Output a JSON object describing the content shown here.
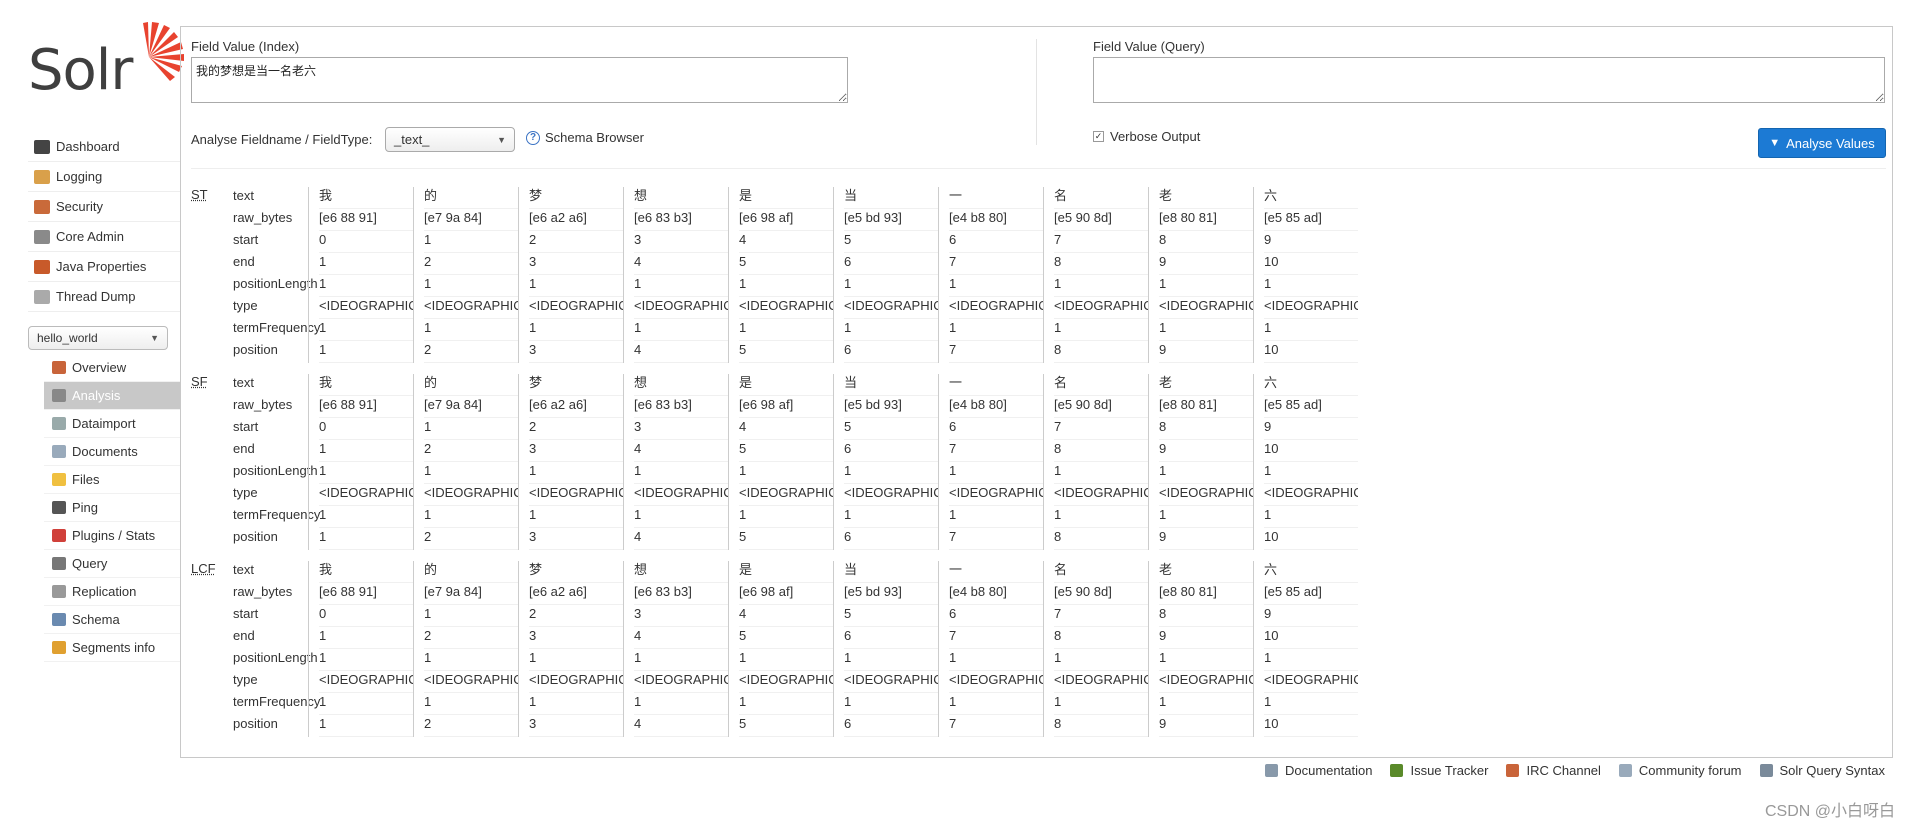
{
  "app": {
    "logo_text": "Solr"
  },
  "nav": [
    {
      "label": "Dashboard",
      "icon": "dashboard-icon",
      "color": "#444"
    },
    {
      "label": "Logging",
      "icon": "logging-icon",
      "color": "#d9a04a"
    },
    {
      "label": "Security",
      "icon": "security-icon",
      "color": "#c96a3a"
    },
    {
      "label": "Core Admin",
      "icon": "core-admin-icon",
      "color": "#8a8a8a"
    },
    {
      "label": "Java Properties",
      "icon": "java-properties-icon",
      "color": "#c85a2a"
    },
    {
      "label": "Thread Dump",
      "icon": "thread-dump-icon",
      "color": "#aaa"
    }
  ],
  "core_selector": {
    "value": "hello_world"
  },
  "core_nav": [
    {
      "label": "Overview",
      "icon": "overview-icon",
      "color": "#c8643a"
    },
    {
      "label": "Analysis",
      "icon": "analysis-icon",
      "color": "#888",
      "active": true
    },
    {
      "label": "Dataimport",
      "icon": "dataimport-icon",
      "color": "#9aa"
    },
    {
      "label": "Documents",
      "icon": "documents-icon",
      "color": "#9ab"
    },
    {
      "label": "Files",
      "icon": "files-icon",
      "color": "#f0c040"
    },
    {
      "label": "Ping",
      "icon": "ping-icon",
      "color": "#555"
    },
    {
      "label": "Plugins / Stats",
      "icon": "plugins-icon",
      "color": "#d0403a"
    },
    {
      "label": "Query",
      "icon": "query-icon",
      "color": "#777"
    },
    {
      "label": "Replication",
      "icon": "replication-icon",
      "color": "#999"
    },
    {
      "label": "Schema",
      "icon": "schema-icon",
      "color": "#6a8ab0"
    },
    {
      "label": "Segments info",
      "icon": "segments-icon",
      "color": "#e0a030"
    }
  ],
  "form": {
    "index_label": "Field Value (Index)",
    "index_value": "我的梦想是当一名老六",
    "query_label": "Field Value (Query)",
    "query_value": "",
    "fieldtype_label": "Analyse Fieldname / FieldType:",
    "fieldtype_value": "_text_",
    "schema_browser": "Schema Browser",
    "verbose_label": "Verbose Output",
    "verbose_checked": true,
    "analyse_button": "Analyse Values"
  },
  "analysis": {
    "attributes": [
      "text",
      "raw_bytes",
      "start",
      "end",
      "positionLength",
      "type",
      "termFrequency",
      "position"
    ],
    "stages": [
      {
        "name": "ST"
      },
      {
        "name": "SF"
      },
      {
        "name": "LCF"
      }
    ],
    "tokens": [
      {
        "text": "我",
        "raw_bytes": "[e6 88 91]",
        "start": "0",
        "end": "1",
        "positionLength": "1",
        "type": "<IDEOGRAPHIC>",
        "termFrequency": "1",
        "position": "1"
      },
      {
        "text": "的",
        "raw_bytes": "[e7 9a 84]",
        "start": "1",
        "end": "2",
        "positionLength": "1",
        "type": "<IDEOGRAPHIC>",
        "termFrequency": "1",
        "position": "2"
      },
      {
        "text": "梦",
        "raw_bytes": "[e6 a2 a6]",
        "start": "2",
        "end": "3",
        "positionLength": "1",
        "type": "<IDEOGRAPHIC>",
        "termFrequency": "1",
        "position": "3"
      },
      {
        "text": "想",
        "raw_bytes": "[e6 83 b3]",
        "start": "3",
        "end": "4",
        "positionLength": "1",
        "type": "<IDEOGRAPHIC>",
        "termFrequency": "1",
        "position": "4"
      },
      {
        "text": "是",
        "raw_bytes": "[e6 98 af]",
        "start": "4",
        "end": "5",
        "positionLength": "1",
        "type": "<IDEOGRAPHIC>",
        "termFrequency": "1",
        "position": "5"
      },
      {
        "text": "当",
        "raw_bytes": "[e5 bd 93]",
        "start": "5",
        "end": "6",
        "positionLength": "1",
        "type": "<IDEOGRAPHIC>",
        "termFrequency": "1",
        "position": "6"
      },
      {
        "text": "一",
        "raw_bytes": "[e4 b8 80]",
        "start": "6",
        "end": "7",
        "positionLength": "1",
        "type": "<IDEOGRAPHIC>",
        "termFrequency": "1",
        "position": "7"
      },
      {
        "text": "名",
        "raw_bytes": "[e5 90 8d]",
        "start": "7",
        "end": "8",
        "positionLength": "1",
        "type": "<IDEOGRAPHIC>",
        "termFrequency": "1",
        "position": "8"
      },
      {
        "text": "老",
        "raw_bytes": "[e8 80 81]",
        "start": "8",
        "end": "9",
        "positionLength": "1",
        "type": "<IDEOGRAPHIC>",
        "termFrequency": "1",
        "position": "9"
      },
      {
        "text": "六",
        "raw_bytes": "[e5 85 ad]",
        "start": "9",
        "end": "10",
        "positionLength": "1",
        "type": "<IDEOGRAPHIC>",
        "termFrequency": "1",
        "position": "10"
      }
    ]
  },
  "footer": [
    {
      "label": "Documentation",
      "icon": "documentation-icon",
      "color": "#8899aa"
    },
    {
      "label": "Issue Tracker",
      "icon": "bug-icon",
      "color": "#5a8a2a"
    },
    {
      "label": "IRC Channel",
      "icon": "irc-icon",
      "color": "#c9643a"
    },
    {
      "label": "Community forum",
      "icon": "mail-icon",
      "color": "#99aabb"
    },
    {
      "label": "Solr Query Syntax",
      "icon": "syntax-icon",
      "color": "#7a8a9a"
    }
  ],
  "watermark": "CSDN @小白呀白",
  "colors": {
    "accent": "#1c7ad4",
    "logo_sun": "#e8432f"
  }
}
